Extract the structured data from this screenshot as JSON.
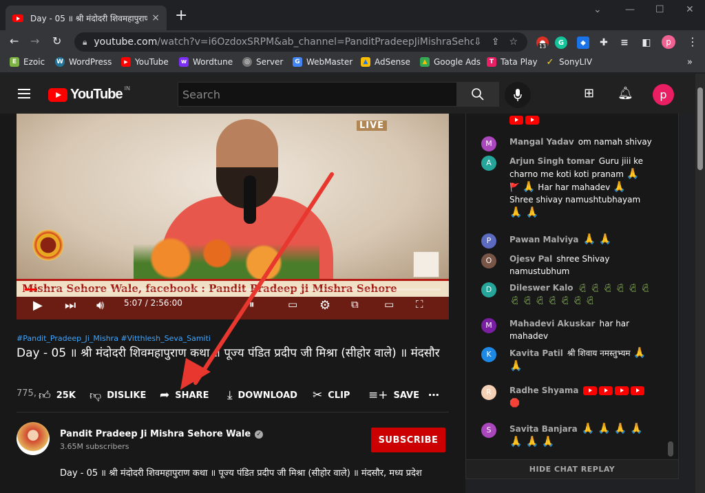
{
  "browser": {
    "tab_title": "Day - 05 ॥ श्री मंदोदरी शिवमहापुराण",
    "tab_close": "×",
    "new_tab": "+",
    "url_host": "youtube.com",
    "url_rest": "/watch?v=i6OzdoxSRPM&ab_channel=PanditPradeepJiMishraSehoreW...",
    "ext_badge": "13",
    "profile_letter": "p",
    "bookmarks": [
      {
        "label": "Ezoic",
        "color": "#7cb342",
        "icon": "E"
      },
      {
        "label": "WordPress",
        "color": "#21759b",
        "icon": "W"
      },
      {
        "label": "YouTube",
        "color": "#ff0000",
        "icon": "▶"
      },
      {
        "label": "Wordtune",
        "color": "#7b2ff7",
        "icon": "w"
      },
      {
        "label": "Server",
        "color": "#9e9e9e",
        "icon": "◎"
      },
      {
        "label": "WebMaster",
        "color": "#4285f4",
        "icon": "G"
      },
      {
        "label": "AdSense",
        "color": "#fbbc04",
        "icon": "▲"
      },
      {
        "label": "Google Ads",
        "color": "#34a853",
        "icon": "▲"
      },
      {
        "label": "Tata Play",
        "color": "#e91e63",
        "icon": "T"
      },
      {
        "label": "SonyLIV",
        "color": "#fdd835",
        "icon": "✓"
      }
    ],
    "bookmarks_more": "»"
  },
  "youtube": {
    "logo_text": "YouTube",
    "country_code": "IN",
    "search_placeholder": "Search",
    "user_letter": "p"
  },
  "video": {
    "live_label": "LIVE",
    "ticker_text": "Mishra Sehore Wale, facebook : Pandit Pradeep ji Mishra Sehore",
    "time": "5:07 / 2:56:00",
    "progress_fraction": 0.03,
    "hashtags": "#Pandit_Pradeep_Ji_Mishra #Vitthlesh_Seva_Samiti",
    "title": "Day - 05 ॥ श्री मंदोदरी शिवमहापुराण कथा ॥ पूज्य पंडित प्रदीप जी मिश्रा (सीहोर वाले) ॥ मंदसौर",
    "views_partial": "775,",
    "like_count": "25K",
    "dislike_label": "DISLIKE",
    "share_label": "SHARE",
    "download_label": "DOWNLOAD",
    "clip_label": "CLIP",
    "save_label": "SAVE",
    "more_label": "⋯"
  },
  "channel": {
    "name": "Pandit Pradeep Ji Mishra Sehore Wale",
    "subscribers": "3.65M subscribers",
    "subscribe_label": "SUBSCRIBE",
    "description": "Day - 05 ॥ श्री मंदोदरी शिवमहापुराण कथा ॥ पूज्य पंडित प्रदीप जी मिश्रा (सीहोर वाले) ॥ मंदसौर, मध्य प्रदेश"
  },
  "chat": {
    "messages": [
      {
        "author": "Mangal Yadav",
        "initial": "M",
        "color": "#ab47bc",
        "text": "om namah shivay"
      },
      {
        "author": "Arjun Singh tomar",
        "initial": "A",
        "color": "#26a69a",
        "text": "Guru jiii ke charno me koti koti pranam",
        "text2": "Har har mahadev",
        "text3": "Shree shivay namushtubhayam"
      },
      {
        "author": "Pawan Malviya",
        "initial": "P",
        "color": "#5c6bc0",
        "text": ""
      },
      {
        "author": "Ojesv Pal",
        "initial": "O",
        "color": "#795548",
        "text": "shree Shivay namustubhum"
      },
      {
        "author": "Dileswer Kalo",
        "initial": "D",
        "color": "#26a69a",
        "text": ""
      },
      {
        "author": "Mahadevi Akuskar",
        "initial": "M",
        "color": "#7b1fa2",
        "text": "har har mahadev"
      },
      {
        "author": "Kavita Patil",
        "initial": "K",
        "color": "#1e88e5",
        "text": "श्री शिवाय नमस्तुभ्यम"
      },
      {
        "author": "Radhe Shyama",
        "initial": "R",
        "color": "#f5d0b5",
        "text": ""
      },
      {
        "author": "Savita Banjara",
        "initial": "S",
        "color": "#ab47bc",
        "text": ""
      }
    ],
    "hide_label": "HIDE CHAT REPLAY"
  },
  "colors": {
    "accent_red": "#ff0000",
    "subscribe_red": "#cc0000",
    "link_blue": "#3ea6ff",
    "annotation_arrow": "#e8372f"
  }
}
